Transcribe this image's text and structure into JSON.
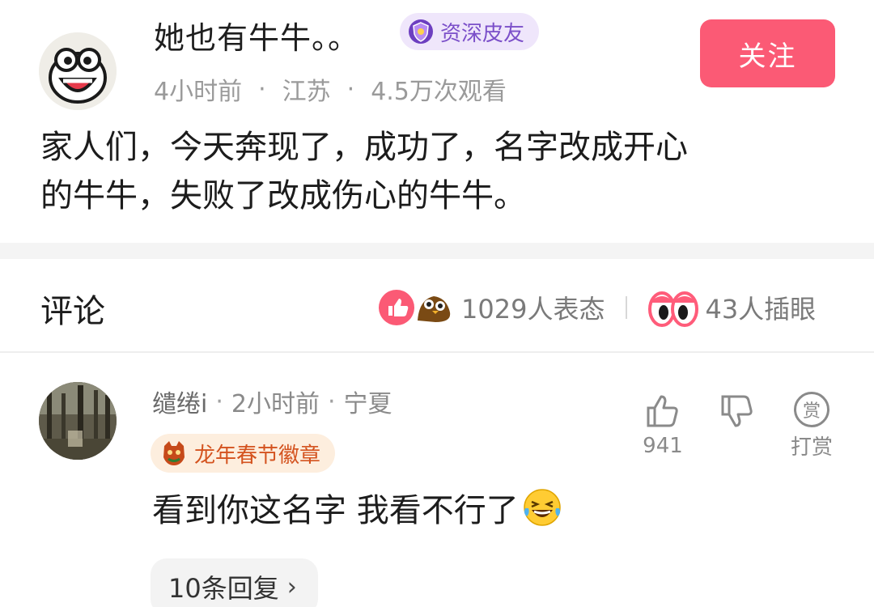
{
  "post": {
    "author": "她也有牛牛。。",
    "badge": "资深皮友",
    "follow_label": "关注",
    "time": "4小时前",
    "location": "江苏",
    "views": "4.5万次观看",
    "body_line1": "家人们，今天奔现了，成功了，名字改成开心",
    "body_line2": "的牛牛，失败了改成伤心的牛牛。"
  },
  "comments_header": {
    "title": "评论",
    "reaction_count": "1029人表态",
    "eye_count": "43人插眼"
  },
  "comment": {
    "user": "缱绻i",
    "time": "2小时前",
    "location": "宁夏",
    "badge": "龙年春节徽章",
    "text": "看到你这名字 我看不行了",
    "like_count": "941",
    "tip_label": "打赏",
    "tip_icon_char": "赏",
    "replies_label": "10条回复"
  },
  "colors": {
    "follow_button": "#fb5a75",
    "badge_purple": "#7b4fc9",
    "badge_orange": "#d4531f"
  }
}
